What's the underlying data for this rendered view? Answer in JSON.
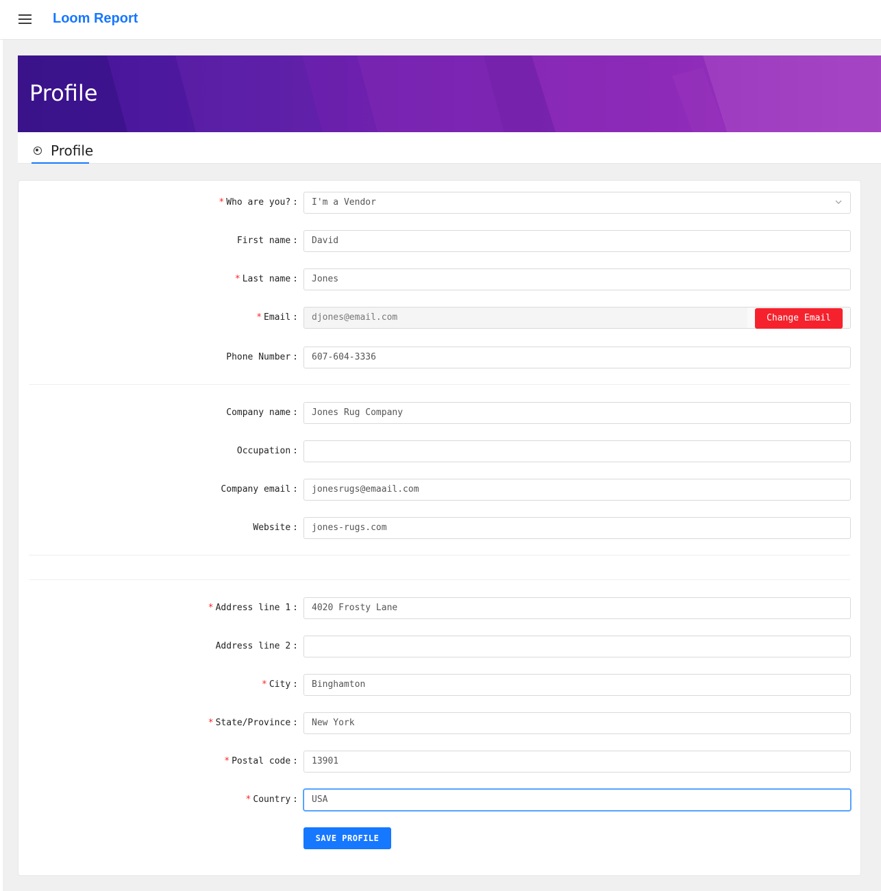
{
  "app": {
    "title": "Loom Report"
  },
  "header": {
    "title": "Profile"
  },
  "tabs": [
    {
      "label": "Profile",
      "active": true
    }
  ],
  "form": {
    "who": {
      "label": "Who are you?",
      "value": "I'm a Vendor",
      "required": true
    },
    "first_name": {
      "label": "First name",
      "value": "David"
    },
    "last_name": {
      "label": "Last name",
      "value": "Jones",
      "required": true
    },
    "email": {
      "label": "Email",
      "value": "djones@email.com",
      "required": true,
      "action": "Change Email"
    },
    "phone": {
      "label": "Phone Number",
      "value": "607-604-3336"
    },
    "company_name": {
      "label": "Company name",
      "value": "Jones Rug Company"
    },
    "occupation": {
      "label": "Occupation",
      "value": ""
    },
    "company_email": {
      "label": "Company email",
      "value": "jonesrugs@emaail.com"
    },
    "website": {
      "label": "Website",
      "value": "jones-rugs.com"
    },
    "address1": {
      "label": "Address line 1",
      "value": "4020 Frosty Lane",
      "required": true
    },
    "address2": {
      "label": "Address line 2",
      "value": ""
    },
    "city": {
      "label": "City",
      "value": "Binghamton",
      "required": true
    },
    "state": {
      "label": "State/Province",
      "value": "New York",
      "required": true
    },
    "postal": {
      "label": "Postal code",
      "value": "13901",
      "required": true
    },
    "country": {
      "label": "Country",
      "value": "USA",
      "required": true
    },
    "save_label": "SAVE PROFILE"
  },
  "colors": {
    "primary": "#1677ff",
    "danger": "#f5222d",
    "hero_start": "#3e1592",
    "hero_end": "#a646c4"
  },
  "icons": {
    "menu": "hamburger-icon",
    "tab": "radio-target-icon",
    "select": "chevron-down-icon"
  }
}
